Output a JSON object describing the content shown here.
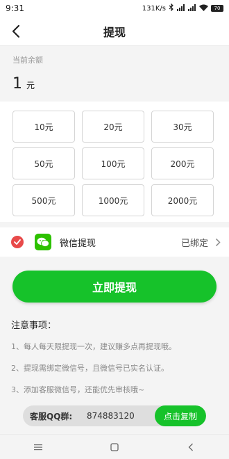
{
  "status_bar": {
    "time": "9:31",
    "network_speed": "131K/s",
    "battery": "70",
    "icons": [
      "bluetooth-icon",
      "signal-icon",
      "signal-icon",
      "wifi-icon",
      "battery-icon"
    ]
  },
  "header": {
    "title": "提现",
    "back_icon": "back-arrow-icon"
  },
  "balance": {
    "label": "当前余额",
    "amount": "1",
    "unit": "元"
  },
  "amounts": {
    "options": [
      "10元",
      "20元",
      "30元",
      "50元",
      "100元",
      "200元",
      "500元",
      "1000元",
      "2000元"
    ]
  },
  "payment": {
    "selected_icon": "check-circle-icon",
    "method_icon": "wechat-icon",
    "label": "微信提现",
    "status": "已绑定"
  },
  "submit": {
    "label": "立即提现"
  },
  "notes": {
    "title": "注意事项：",
    "items": [
      "1、每人每天限提现一次，建议赚多点再提现哦。",
      "2、提现需绑定微信号，且微信号已实名认证。",
      "3、添加客服微信号，还能优先审核哦~"
    ]
  },
  "qq_group": {
    "label": "客服QQ群:",
    "number": "874883120",
    "copy_label": "点击复制"
  },
  "colors": {
    "primary_green": "#16c22a",
    "check_red": "#e84a4a",
    "wechat_green": "#2dc100"
  }
}
